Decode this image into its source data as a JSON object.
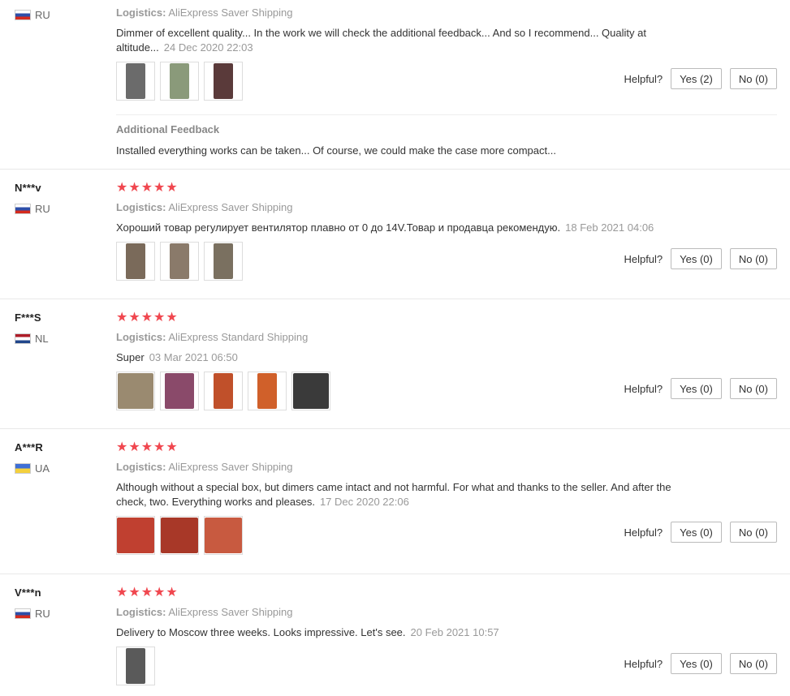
{
  "helpful_label": "Helpful?",
  "reviews": [
    {
      "name": "",
      "country": "RU",
      "stars": "★★★★★",
      "logistics_label": "Logistics:",
      "logistics_value": "AliExpress Saver Shipping",
      "text": "Dimmer of excellent quality... In the work we will check the additional feedback... And so I recommend... Quality at altitude...",
      "date": "24 Dec 2020 22:03",
      "photos": [
        "#6b6b6b",
        "#8a9a7a",
        "#5a3a3a"
      ],
      "yes": "Yes (2)",
      "no": "No (0)",
      "additional_title": "Additional Feedback",
      "additional_text": "Installed everything works can be taken... Of course, we could make the case more compact..."
    },
    {
      "name": "N***v",
      "country": "RU",
      "stars": "★★★★★",
      "logistics_label": "Logistics:",
      "logistics_value": "AliExpress Saver Shipping",
      "text": "Хороший товар регулирует вентилятор плавно от 0 до 14V.Товар и продавца рекомендую.",
      "date": "18 Feb 2021 04:06",
      "photos": [
        "#7a6a5a",
        "#8a7a6a",
        "#7a7060"
      ],
      "yes": "Yes (0)",
      "no": "No (0)"
    },
    {
      "name": "F***S",
      "country": "NL",
      "stars": "★★★★★",
      "logistics_label": "Logistics:",
      "logistics_value": "AliExpress Standard Shipping",
      "text": "Super",
      "date": "03 Mar 2021 06:50",
      "photos": [
        "#9a8a70",
        "#8a4a6a",
        "#c0502a",
        "#d0602a",
        "#3a3a3a"
      ],
      "yes": "Yes (0)",
      "no": "No (0)"
    },
    {
      "name": "A***R",
      "country": "UA",
      "stars": "★★★★★",
      "logistics_label": "Logistics:",
      "logistics_value": "AliExpress Saver Shipping",
      "text": "Although without a special box, but dimers came intact and not harmful. For what and thanks to the seller. And after the check, two. Everything works and pleases.",
      "date": "17 Dec 2020 22:06",
      "photos": [
        "#c04030",
        "#a83828",
        "#c85a40"
      ],
      "yes": "Yes (0)",
      "no": "No (0)"
    },
    {
      "name": "V***n",
      "country": "RU",
      "stars": "★★★★★",
      "logistics_label": "Logistics:",
      "logistics_value": "AliExpress Saver Shipping",
      "text": "Delivery to Moscow three weeks. Looks impressive. Let's see.",
      "date": "20 Feb 2021 10:57",
      "photos": [
        "#5a5a5a"
      ],
      "yes": "Yes (0)",
      "no": "No (0)"
    }
  ]
}
